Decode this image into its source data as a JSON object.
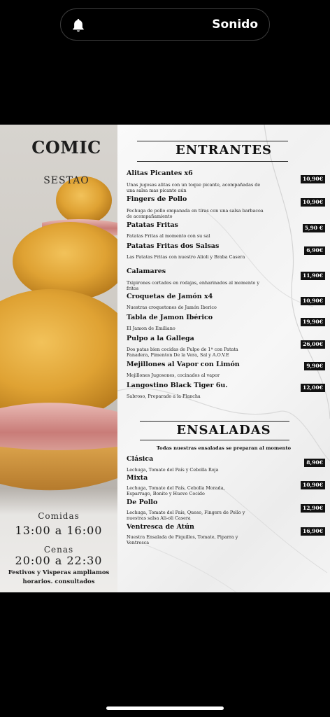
{
  "notification": {
    "label": "Sonido",
    "icon": "bell-icon"
  },
  "restaurant": {
    "name": "COMIC",
    "subtitle": "SESTAO"
  },
  "hours": {
    "lunch_label": "Comidas",
    "lunch_time": "13:00 a 16:00",
    "dinner_label": "Cenas",
    "dinner_time": "20:00 a 22:30",
    "note": "Festivos y Visperas ampliamos horarios. consultados"
  },
  "entrantes": {
    "title": "ENTRANTES",
    "items": [
      {
        "name": "Alitas Picantes x6",
        "desc": "Unas jugosas alitas con un toque picante, acompañadas de una salsa mas picante aún",
        "price": "10,90€"
      },
      {
        "name": "Fingers de Pollo",
        "desc": "Pechuga de pollo empanada en tiras con una salsa barbacoa de acompañamiento",
        "price": "10,90€"
      },
      {
        "name": "Patatas Fritas",
        "desc": "Patatas Fritas al momento con su sal",
        "price": "5,90 €"
      },
      {
        "name": "Patatas Fritas dos Salsas",
        "desc": "Las Patatas Fritas con nuestro Alioli y Braba Casera",
        "price": "6,90€"
      },
      {
        "name": "Calamares",
        "desc": "Txipirones cortados en rodajas, enharinados al momento y fritos",
        "price": "11,90€"
      },
      {
        "name": "Croquetas de Jamón x4",
        "desc": "Nuestras croquetones de Jamón Iberico",
        "price": "10,90€"
      },
      {
        "name": "Tabla de Jamon Ibérico",
        "desc": "El Jamon de Emiliano",
        "price": "19,90€"
      },
      {
        "name": "Pulpo a la Gallega",
        "desc": "Dos patas bien cocidas de Pulpo de 1ª con Patata Panadera, Pimenton De la Vera, Sal y A.O.V.E",
        "price": "26,00€"
      },
      {
        "name": "Mejillones al Vapor con Limón",
        "desc": "Mejillones Jugosones, cocinados al vapor",
        "price": "9,90€"
      },
      {
        "name": "Langostino Black Tiger 6u.",
        "desc": "Sabroso, Preparado a la Plancha",
        "price": "12,00€"
      }
    ]
  },
  "ensaladas": {
    "title": "ENSALADAS",
    "note": "Todas nuestras ensaladas se preparan al momento",
    "items": [
      {
        "name": "Clásica",
        "desc": "Lechuga, Tomate del País y Cebolla Roja",
        "price": "8,90€"
      },
      {
        "name": "Mixta",
        "desc": "Lechuga, Tomate del País, Cebolla Morada, Esparrago, Bonito y Huevo Cocido",
        "price": "10,90€"
      },
      {
        "name": "De Pollo",
        "desc": "Lechuga, Tomate del País, Queso, Fingers de Pollo y nuestras salsa Ali-oli Casera",
        "price": "12,90€"
      },
      {
        "name": "Ventresca de Atún",
        "desc": "Nuestra Ensalada de Piquillos, Tomate, Piparra y Ventresca",
        "price": "16,90€"
      }
    ]
  }
}
